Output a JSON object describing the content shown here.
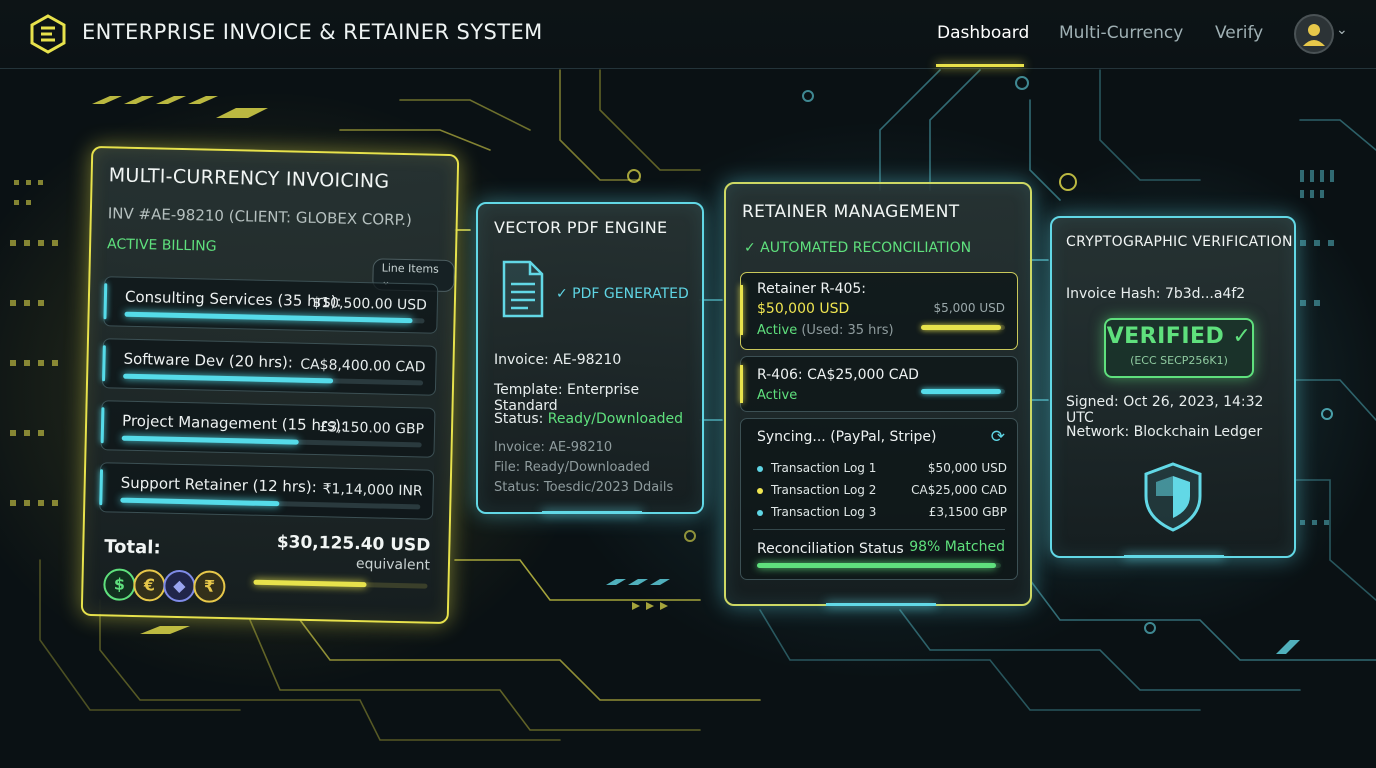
{
  "header": {
    "app_title": "ENTERPRISE INVOICE & RETAINER SYSTEM",
    "nav": [
      "Dashboard",
      "Multi-Currency",
      "Verify"
    ]
  },
  "invoicing": {
    "title": "MULTI-CURRENCY INVOICING",
    "invoice_id": "INV #AE-98210 (CLIENT: GLOBEX CORP.)",
    "status": "ACTIVE BILLING",
    "line_items_label": "Line Items",
    "items": [
      {
        "label": "Consulting Services (35 hrs):",
        "amount": "$10,500.00 USD",
        "progress": 0.96
      },
      {
        "label": "Software Dev (20 hrs):",
        "amount": "CA$8,400.00 CAD",
        "progress": 0.7
      },
      {
        "label": "Project Management (15 hrs):",
        "amount": "£3,150.00 GBP",
        "progress": 0.59
      },
      {
        "label": "Support Retainer (12 hrs):",
        "amount": "₹1,14,000 INR",
        "progress": 0.53
      }
    ],
    "total_label": "Total:",
    "total_value": "$30,125.40 USD",
    "total_note": "equivalent",
    "total_progress": 0.65,
    "currency_symbols": [
      "$",
      "€",
      "◆",
      "₹"
    ]
  },
  "pdf": {
    "title": "VECTOR PDF ENGINE",
    "status": "✓ PDF GENERATED",
    "invoice_line": "Invoice: AE-98210",
    "template_line": "Template: Enterprise Standard",
    "status_label": "Status:",
    "status_value": "Ready/Downloaded",
    "meta_invoice": "Invoice: AE-98210",
    "meta_file": "File: Ready/Downloaded",
    "meta_status": "Status: Toesdic/2023 Ddails"
  },
  "retainer": {
    "title": "RETAINER MANAGEMENT",
    "subtitle": "✓ AUTOMATED RECONCILIATION",
    "r405_title": "Retainer R-405:",
    "r405_amount": "$50,000 USD",
    "r405_status": "Active",
    "r405_used": "(Used: 35 hrs)",
    "r405_side": "$5,000 USD",
    "r405_progress": 0.95,
    "r406_title": "R-406: CA$25,000 CAD",
    "r406_status": "Active",
    "r406_progress": 0.95,
    "sync_title": "Syncing... (PayPal, Stripe)",
    "logs": [
      {
        "label": "Transaction Log 1",
        "value": "$50,000 USD",
        "color": "#5fd5e4"
      },
      {
        "label": "Transaction Log 2",
        "value": "CA$25,000 CAD",
        "color": "#efe551"
      },
      {
        "label": "Transaction Log 3",
        "value": "£3,1500 GBP",
        "color": "#5fd5e4"
      }
    ],
    "recon_label": "Reconciliation Status",
    "recon_value": "98% Matched",
    "recon_progress": 0.98
  },
  "verification": {
    "title": "CRYPTOGRAPHIC VERIFICATION",
    "hash": "Invoice Hash: 7b3d...a4f2",
    "stamp_title": "VERIFIED ✓",
    "stamp_sub": "(ECC SECP256K1)",
    "signed": "Signed: Oct 26, 2023, 14:32 UTC",
    "network": "Network: Blockchain Ledger"
  },
  "colors": {
    "accent_yellow": "#e7e24c",
    "accent_cyan": "#62d8e6",
    "success_green": "#5fe07d"
  }
}
